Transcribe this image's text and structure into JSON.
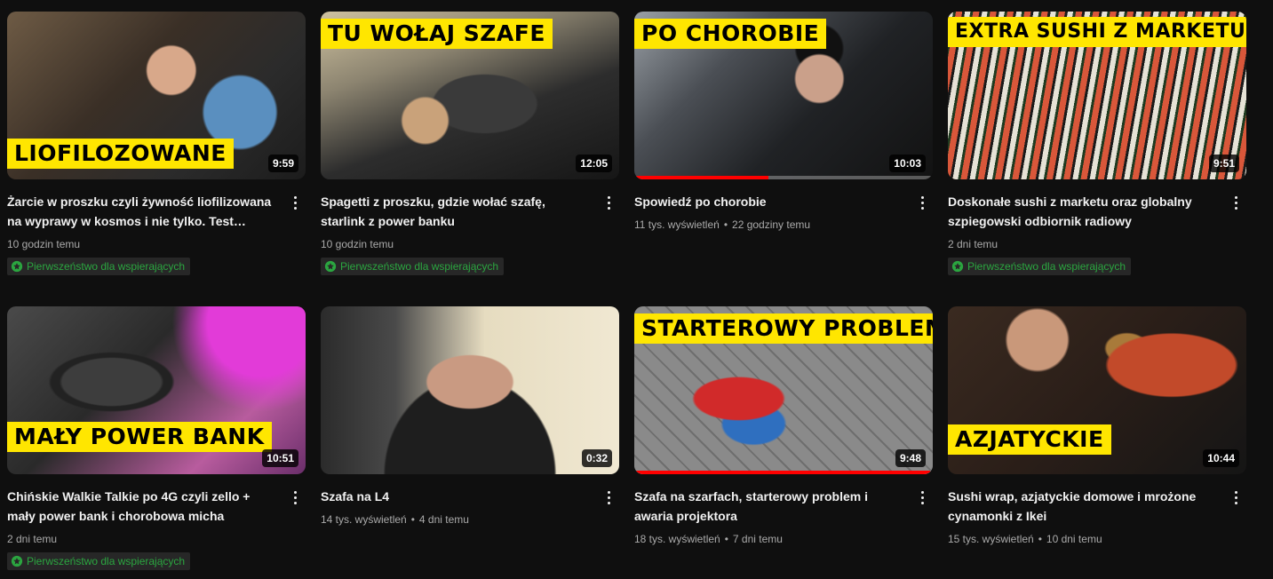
{
  "colors": {
    "background": "#0f0f0f",
    "overlay_yellow": "#ffe600",
    "badge_green": "#2ba640",
    "progress_red": "#ff0000"
  },
  "badge_icon": "star-circle-icon",
  "menu_icon": "more-vert-icon",
  "videos": [
    {
      "overlay": "LIOFILOZOWANE",
      "duration": "9:59",
      "title": "Żarcie w proszku czyli żywność liofilizowana na wyprawy w kosmos i nie tylko. Test…",
      "views": "",
      "age": "10 godzin temu",
      "badge": "Pierwszeństwo dla wspierających"
    },
    {
      "overlay": "TU WOŁAJ SZAFE",
      "duration": "12:05",
      "title": "Spagetti z proszku, gdzie wołać szafę, starlink z power banku",
      "views": "",
      "age": "10 godzin temu",
      "badge": "Pierwszeństwo dla wspierających"
    },
    {
      "overlay": "PO CHOROBIE",
      "duration": "10:03",
      "title": "Spowiedź po chorobie",
      "views": "11 tys. wyświetleń",
      "age": "22 godziny temu",
      "badge": "",
      "progress": 0.45
    },
    {
      "overlay": "EXTRA SUSHI Z MARKETU",
      "duration": "9:51",
      "title": "Doskonałe sushi z marketu oraz globalny szpiegowski odbiornik radiowy",
      "views": "",
      "age": "2 dni temu",
      "badge": "Pierwszeństwo dla wspierających"
    },
    {
      "overlay": "MAŁY POWER BANK",
      "duration": "10:51",
      "title": "Chińskie Walkie Talkie po 4G czyli zello + mały power bank i chorobowa micha",
      "views": "",
      "age": "2 dni temu",
      "badge": "Pierwszeństwo dla wspierających"
    },
    {
      "overlay": "",
      "duration": "0:32",
      "title": "Szafa na L4",
      "views": "14 tys. wyświetleń",
      "age": "4 dni temu",
      "badge": ""
    },
    {
      "overlay": "STARTEROWY PROBLEM",
      "duration": "9:48",
      "title": "Szafa na szarfach, starterowy problem i awaria projektora",
      "views": "18 tys. wyświetleń",
      "age": "7 dni temu",
      "badge": "",
      "progress": 0.99
    },
    {
      "overlay": "AZJATYCKIE",
      "duration": "10:44",
      "title": "Sushi wrap, azjatyckie domowe i mrożone cynamonki z Ikei",
      "views": "15 tys. wyświetleń",
      "age": "10 dni temu",
      "badge": ""
    }
  ]
}
